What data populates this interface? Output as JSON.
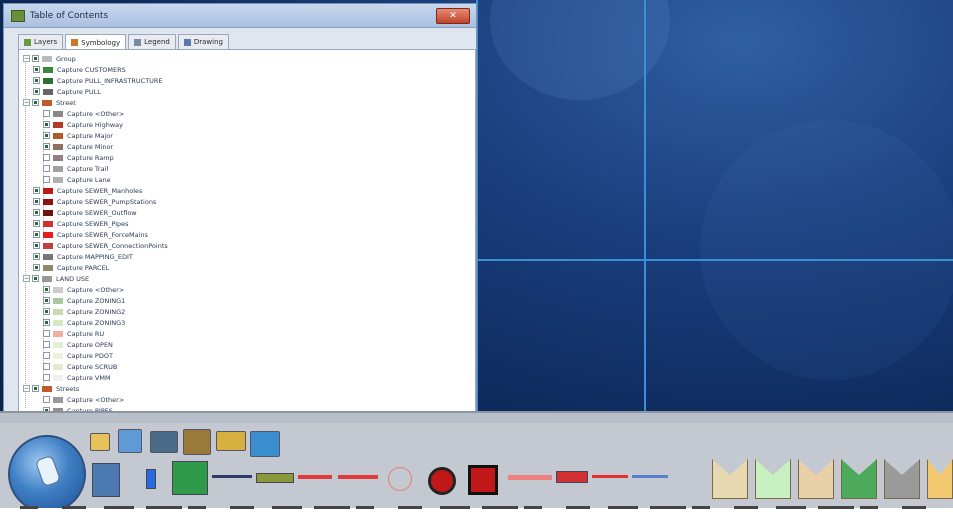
{
  "window": {
    "title": "Table of Contents",
    "close_label": "✕"
  },
  "tabs": [
    {
      "label": "Layers"
    },
    {
      "label": "Symbology"
    },
    {
      "label": "Legend"
    },
    {
      "label": "Drawing"
    }
  ],
  "tree": [
    {
      "label": "Group",
      "checked": true,
      "expander": true,
      "color": ""
    },
    {
      "label": "Capture CUSTOMERS",
      "checked": true,
      "color": "#3a8a3a"
    },
    {
      "label": "Capture PULL_INFRASTRUCTURE",
      "checked": true,
      "color": "#2f6f2f"
    },
    {
      "label": "Capture PULL",
      "checked": true,
      "color": "#666666"
    },
    {
      "label": "Street",
      "checked": true,
      "expander": true,
      "color": "#c05a2a"
    },
    {
      "label": "Capture <Other>",
      "checked": false,
      "color": "#888888"
    },
    {
      "label": "Capture Highway",
      "checked": true,
      "color": "#b23a2a"
    },
    {
      "label": "Capture Major",
      "checked": true,
      "color": "#b05a2a"
    },
    {
      "label": "Capture Minor",
      "checked": true,
      "color": "#907060"
    },
    {
      "label": "Capture Ramp",
      "checked": false,
      "color": "#908080"
    },
    {
      "label": "Capture Trail",
      "checked": false,
      "color": "#a0a0a0"
    },
    {
      "label": "Capture Lane",
      "checked": false,
      "color": "#b0b0b0"
    },
    {
      "label": "Capture SEWER_Manholes",
      "checked": true,
      "color": "#c01818"
    },
    {
      "label": "Capture SEWER_PumpStations",
      "checked": true,
      "color": "#901010"
    },
    {
      "label": "Capture SEWER_Outflow",
      "checked": true,
      "color": "#701010"
    },
    {
      "label": "Capture SEWER_Pipes",
      "checked": true,
      "color": "#d03030"
    },
    {
      "label": "Capture SEWER_ForceMains",
      "checked": true,
      "color": "#e02020"
    },
    {
      "label": "Capture SEWER_ConnectionPoints",
      "checked": true,
      "color": "#c04040"
    },
    {
      "label": "Capture MAPPING_EDIT",
      "checked": true,
      "color": "#777777"
    },
    {
      "label": "Capture PARCEL",
      "checked": true,
      "color": "#8a8a6a"
    },
    {
      "label": "LAND USE",
      "checked": true,
      "expander": true,
      "color": "#999999"
    },
    {
      "label": "Capture <Other>",
      "checked": true,
      "color": "#cccccc"
    },
    {
      "label": "Capture ZONING1",
      "checked": true,
      "color": "#a8c8a0"
    },
    {
      "label": "Capture ZONING2",
      "checked": true,
      "color": "#c8d8b0"
    },
    {
      "label": "Capture ZONING3",
      "checked": true,
      "color": "#d8e8c0"
    },
    {
      "label": "Capture RU",
      "checked": false,
      "color": "#f0b0a0"
    },
    {
      "label": "Capture OPEN",
      "checked": false,
      "color": "#e0f0d0"
    },
    {
      "label": "Capture PDOT",
      "checked": false,
      "color": "#f0f0e0"
    },
    {
      "label": "Capture SCRUB",
      "checked": false,
      "color": "#e8e8d0"
    },
    {
      "label": "Capture VMM",
      "checked": false,
      "color": "#f0f0f0"
    },
    {
      "label": "Streets",
      "checked": true,
      "expander": true,
      "color": "#c05a2a"
    },
    {
      "label": "Capture <Other>",
      "checked": false,
      "color": "#999999"
    },
    {
      "label": "Capture PIPES",
      "checked": true,
      "color": "#909090"
    }
  ],
  "toolbar": {
    "row1_icons": [
      "folder-icon",
      "globe-tool-icon",
      "measure-icon",
      "edit-tool-icon",
      "layer-icon",
      "screen-icon"
    ],
    "row2_icons": [
      "person-icon",
      "blue-marker-icon",
      "green-gate-icon",
      "line-tool-icon",
      "olive-bar-icon",
      "red-dash-icon",
      "red-dash2-icon",
      "crosshair-icon",
      "red-circle-icon",
      "red-square-icon",
      "pink-line-icon",
      "red-bar-icon",
      "red-dashline-icon",
      "blue-dashline-icon"
    ],
    "parcel_icons": [
      "parcel-tan-icon",
      "parcel-lightgreen-icon",
      "parcel-tan2-icon",
      "parcel-green-icon",
      "parcel-gray-icon",
      "parcel-orange-icon"
    ]
  }
}
